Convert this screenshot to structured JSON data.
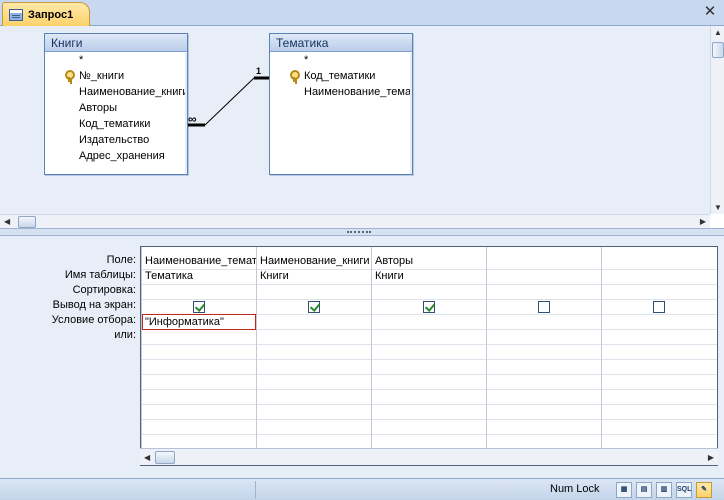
{
  "tab": {
    "label": "Запрос1"
  },
  "tables": [
    {
      "title": "Книги",
      "fields": [
        "*",
        "№_книги",
        "Наименование_книги",
        "Авторы",
        "Код_тематики",
        "Издательство",
        "Адрес_хранения"
      ]
    },
    {
      "title": "Тематика",
      "fields": [
        "*",
        "Код_тематики",
        "Наименование_тематики"
      ]
    }
  ],
  "relationship": {
    "one_label": "1",
    "many_label": "∞"
  },
  "grid": {
    "row_labels": [
      "Поле:",
      "Имя таблицы:",
      "Сортировка:",
      "Вывод на экран:",
      "Условие отбора:",
      "или:"
    ],
    "columns": [
      {
        "field": "Наименование_тематики",
        "table": "Тематика",
        "sort": "",
        "show": true,
        "criteria": "\"Информатика\""
      },
      {
        "field": "Наименование_книги",
        "table": "Книги",
        "sort": "",
        "show": true,
        "criteria": ""
      },
      {
        "field": "Авторы",
        "table": "Книги",
        "sort": "",
        "show": true,
        "criteria": ""
      },
      {
        "field": "",
        "table": "",
        "sort": "",
        "show": false,
        "criteria": ""
      },
      {
        "field": "",
        "table": "",
        "sort": "",
        "show": false,
        "criteria": ""
      }
    ]
  },
  "status": {
    "numlock": "Num Lock",
    "view_buttons": [
      "datasheet-view",
      "pivottable-view",
      "pivotchart-view",
      "SQL",
      "design-view"
    ],
    "active_view": "design-view"
  },
  "colors": {
    "accent": "#fcd26b",
    "pane_bg": "#e8eef7",
    "criteria_border": "#c0281c"
  }
}
